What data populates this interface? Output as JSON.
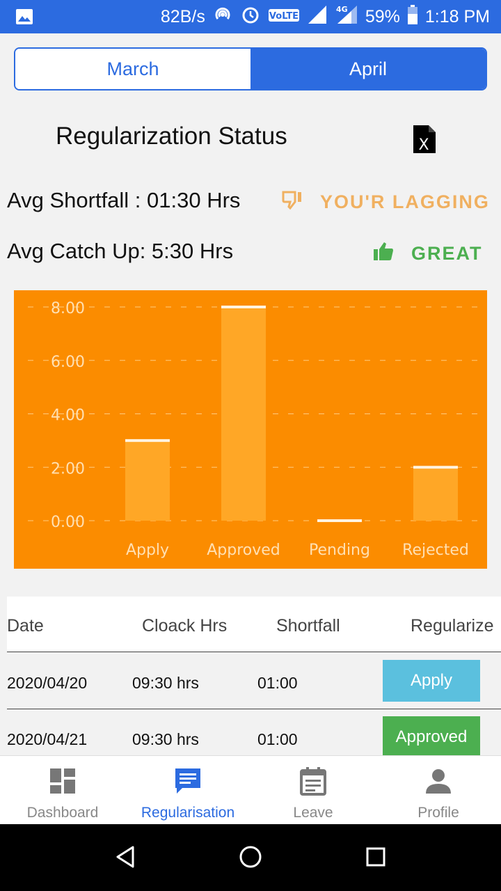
{
  "status_bar": {
    "net_speed": "82B/s",
    "network": "4G",
    "volte": "VoLTE",
    "battery": "59%",
    "time": "1:18 PM"
  },
  "month_tabs": [
    {
      "label": "March",
      "active": false
    },
    {
      "label": "April",
      "active": true
    }
  ],
  "page_title": "Regularization Status",
  "export_icon": "excel-file-icon",
  "metrics": {
    "shortfall": {
      "label": "Avg Shortfall : 01:30 Hrs",
      "status": "YOU'R LAGGING",
      "color": "#f0b060",
      "icon": "thumbs-down-icon"
    },
    "catch_up": {
      "label": "Avg Catch Up: 5:30 Hrs",
      "status": "GREAT",
      "color": "#4caf50",
      "icon": "thumbs-up-icon"
    }
  },
  "chart_data": {
    "type": "bar",
    "categories": [
      "Apply",
      "Approved",
      "Pending",
      "Rejected"
    ],
    "values": [
      3,
      8,
      0,
      2
    ],
    "y_ticks": [
      "0.00",
      "2.00",
      "4.00",
      "6.00",
      "8.00"
    ],
    "ylim": [
      0,
      8
    ],
    "grid": true,
    "background": "#fb8c00",
    "title": "",
    "xlabel": "",
    "ylabel": ""
  },
  "table": {
    "headers": [
      "Date",
      "Cloack Hrs",
      "Shortfall",
      "Regularize"
    ],
    "rows": [
      {
        "date": "2020/04/20",
        "clock": "09:30 hrs",
        "shortfall": "01:00",
        "action": "Apply",
        "action_color": "#5bc0de"
      },
      {
        "date": "2020/04/21",
        "clock": "09:30 hrs",
        "shortfall": "01:00",
        "action": "Approved",
        "action_color": "#4caf50"
      }
    ]
  },
  "bottom_nav": [
    {
      "label": "Dashboard",
      "icon": "dashboard-icon",
      "active": false
    },
    {
      "label": "Regularisation",
      "icon": "message-icon",
      "active": true
    },
    {
      "label": "Leave",
      "icon": "calendar-icon",
      "active": false
    },
    {
      "label": "Profile",
      "icon": "person-icon",
      "active": false
    }
  ],
  "colors": {
    "primary": "#2c6be0",
    "accent_orange": "#fb8c00",
    "nav_inactive": "#888888"
  }
}
